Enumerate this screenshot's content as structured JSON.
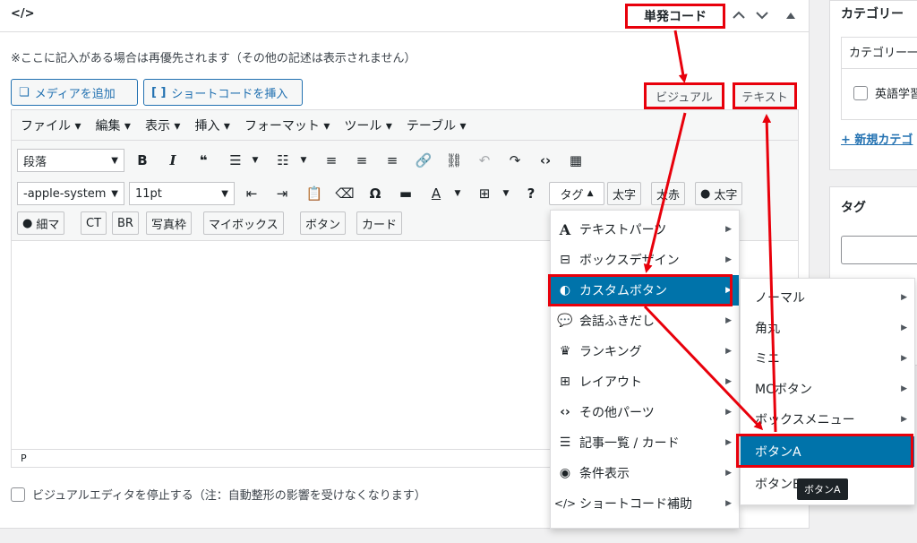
{
  "metabox": {
    "code_icon": "</>",
    "title": "単発コード",
    "note": "※ここに記入がある場合は再優先されます（その他の記述は表示されません）"
  },
  "buttons": {
    "add_media": "メディアを追加",
    "insert_shortcode": "ショートコードを挿入",
    "visual_tab": "ビジュアル",
    "text_tab": "テキスト"
  },
  "menubar": [
    "ファイル",
    "編集",
    "表示",
    "挿入",
    "フォーマット",
    "ツール",
    "テーブル"
  ],
  "toolbar": {
    "format_select": "段落",
    "font_select": "-apple-system",
    "size_select": "11pt",
    "tag_button": "タグ",
    "row2_buttons": [
      "太字",
      "太赤",
      "太字"
    ],
    "row3_buttons": [
      "細マ",
      "CT",
      "BR",
      "写真枠",
      "マイボックス",
      "ボタン",
      "カード"
    ]
  },
  "statusbar": {
    "path": "P"
  },
  "disable_visual": "ビジュアルエディタを停止する（注：自動整形の影響を受けなくなります）",
  "sidebar": {
    "categories": {
      "title": "カテゴリー",
      "tab": "カテゴリー一",
      "item": "英語学習",
      "add_link": "+ 新規カテゴ"
    },
    "tags": {
      "title": "タグ"
    }
  },
  "menu1": {
    "items": [
      {
        "label": "テキストパーツ",
        "icon": "A"
      },
      {
        "label": "ボックスデザイン",
        "icon": "tray-icon"
      },
      {
        "label": "カスタムボタン",
        "icon": "toggle-icon"
      },
      {
        "label": "会話ふきだし",
        "icon": "chat-icon"
      },
      {
        "label": "ランキング",
        "icon": "crown-icon"
      },
      {
        "label": "レイアウト",
        "icon": "grid-icon"
      },
      {
        "label": "その他パーツ",
        "icon": "code-icon"
      },
      {
        "label": "記事一覧 / カード",
        "icon": "list-icon"
      },
      {
        "label": "条件表示",
        "icon": "eye-icon"
      },
      {
        "label": "ショートコード補助",
        "icon": "shortcode-icon"
      }
    ]
  },
  "menu2": {
    "items": [
      "ノーマル",
      "角丸",
      "ミニ",
      "MCボタン",
      "ボックスメニュー",
      "ボタンA",
      "ボタンB"
    ]
  },
  "tooltip": "ボタンA",
  "colors": {
    "accent": "#0073aa",
    "highlight": "#e8000b"
  }
}
